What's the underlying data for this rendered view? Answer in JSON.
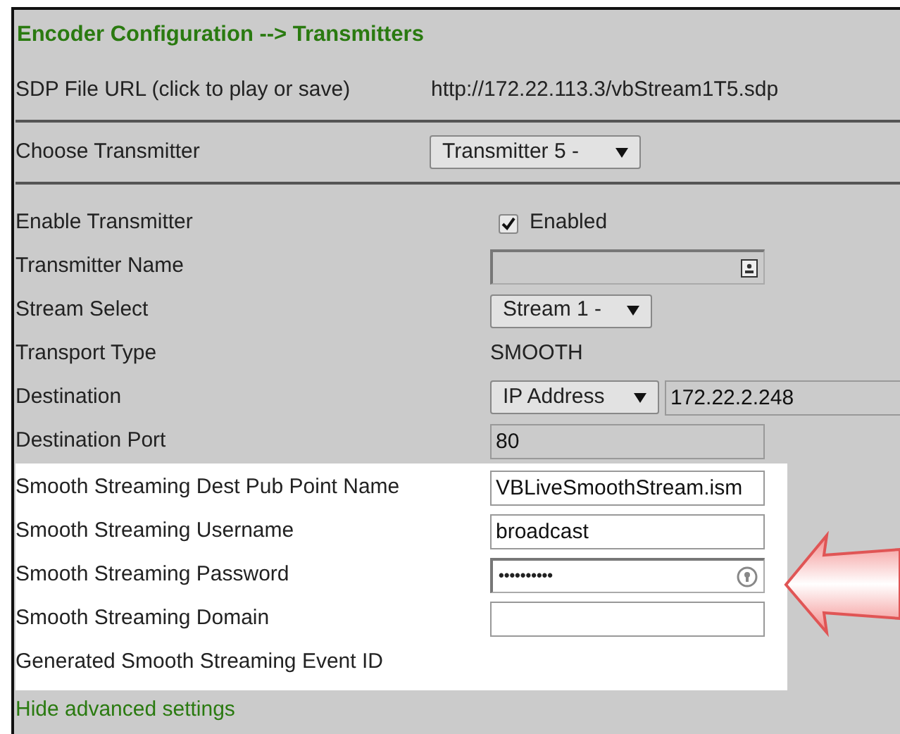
{
  "header": {
    "title": "Encoder Configuration --> Transmitters"
  },
  "sdp": {
    "label": "SDP File URL (click to play or save)",
    "url": "http://172.22.113.3/vbStream1T5.sdp"
  },
  "chooser": {
    "label": "Choose Transmitter",
    "value": "Transmitter 5 -"
  },
  "settings": [
    {
      "kind": "checkbox",
      "label": "Enable Transmitter",
      "option": "Enabled",
      "checked": true
    },
    {
      "kind": "keyfield",
      "label": "Transmitter Name",
      "disabled": true
    },
    {
      "kind": "select",
      "label": "Stream Select",
      "value": "Stream 1 -"
    },
    {
      "kind": "text",
      "label": "Transport Type",
      "value": "SMOOTH"
    },
    {
      "kind": "select-input",
      "label": "Destination",
      "value": "IP Address",
      "input": "172.22.2.248",
      "disabled": true
    },
    {
      "kind": "input",
      "label": "Destination Port",
      "value": "80",
      "disabled": true
    }
  ],
  "highlighted_settings": [
    {
      "kind": "input",
      "label": "Smooth Streaming Dest Pub Point Name",
      "value": "VBLiveSmoothStream.ism",
      "disabled": false
    },
    {
      "kind": "input",
      "label": "Smooth Streaming Username",
      "value": "broadcast",
      "disabled": false
    },
    {
      "kind": "password",
      "label": "Smooth Streaming Password",
      "value": "••••••••••"
    },
    {
      "kind": "input",
      "label": "Smooth Streaming Domain",
      "disabled": false
    },
    {
      "kind": "text",
      "label": "Generated Smooth Streaming Event ID"
    }
  ],
  "footer": {
    "link": "Hide advanced settings"
  }
}
